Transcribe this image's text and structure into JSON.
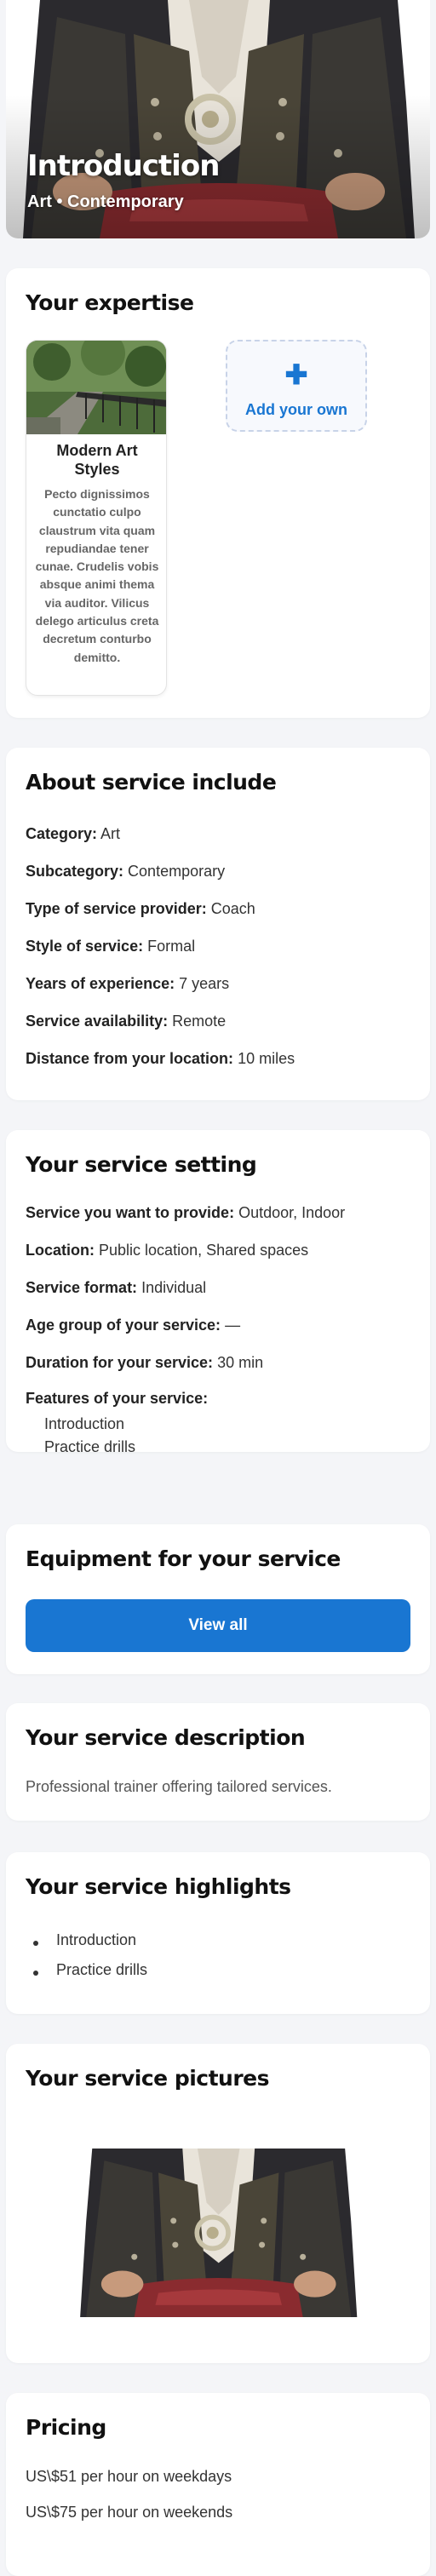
{
  "hero": {
    "title": "Introduction",
    "subtitle": "Art • Contemporary"
  },
  "expertise": {
    "heading": "Your expertise",
    "card": {
      "title": "Modern Art Styles",
      "description": "Pecto dignissimos cunctatio culpo claustrum vita quam repudiandae tener cunae. Crudelis vobis absque animi thema via auditor. Vilicus delego articulus creta decretum conturbo demitto."
    },
    "add_own": {
      "icon": "plus-icon",
      "label": "Add your own"
    }
  },
  "about": {
    "heading": "About service include",
    "rows": [
      {
        "key": "Category:",
        "value": "Art"
      },
      {
        "key": "Subcategory:",
        "value": "Contemporary"
      },
      {
        "key": "Type of service provider:",
        "value": "Coach"
      },
      {
        "key": "Style of service:",
        "value": "Formal"
      },
      {
        "key": "Years of experience:",
        "value": "7 years"
      },
      {
        "key": "Service availability:",
        "value": "Remote"
      },
      {
        "key": "Distance from your location:",
        "value": "10 miles"
      }
    ]
  },
  "setting": {
    "heading": "Your service setting",
    "rows": [
      {
        "key": "Service you want to provide:",
        "value": "Outdoor, Indoor"
      },
      {
        "key": "Location:",
        "value": "Public location, Shared spaces"
      },
      {
        "key": "Service format:",
        "value": "Individual"
      },
      {
        "key": "Age group of your service:",
        "value": "—"
      },
      {
        "key": "Duration for your service:",
        "value": "30 min"
      }
    ],
    "features_label": "Features of your service:",
    "features": [
      "Introduction",
      "Practice drills"
    ]
  },
  "equipment": {
    "heading": "Equipment for your service",
    "button": "View all"
  },
  "description": {
    "heading": "Your service description",
    "text": "Professional trainer offering tailored services."
  },
  "highlights": {
    "heading": "Your service highlights",
    "items": [
      "Introduction",
      "Practice drills"
    ]
  },
  "pictures": {
    "heading": "Your service pictures"
  },
  "pricing": {
    "heading": "Pricing",
    "weekdays": "US\\$51 per hour on weekdays",
    "weekends": "US\\$75 per hour on weekends"
  },
  "colors": {
    "accent": "#1976d2",
    "background": "#f4f5f8",
    "card": "#ffffff"
  }
}
